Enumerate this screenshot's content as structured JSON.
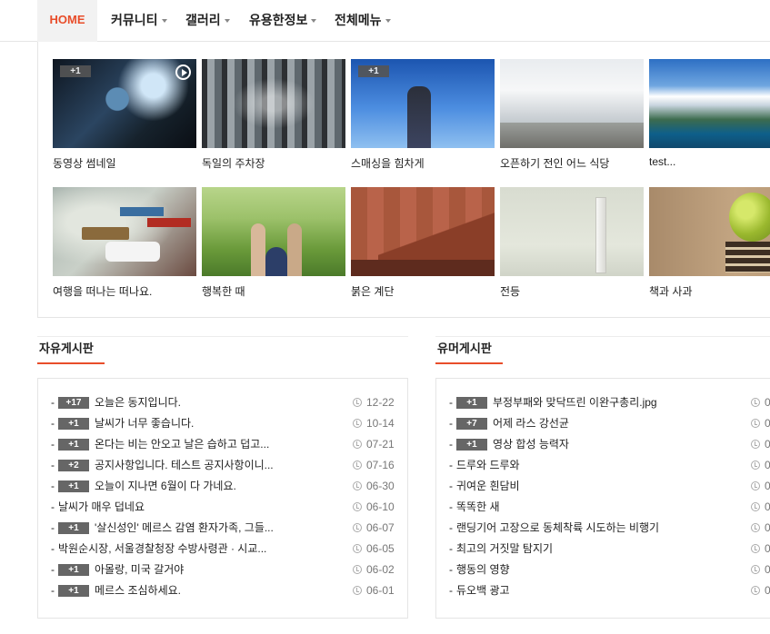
{
  "nav": {
    "home": "HOME",
    "items": [
      "커뮤니티",
      "갤러리",
      "유용한정보",
      "전체메뉴"
    ]
  },
  "gallery": [
    {
      "caption": "동영상 썸네일",
      "badge": "+1",
      "video": true
    },
    {
      "caption": "독일의 주차장"
    },
    {
      "caption": "스매싱을 힘차게",
      "badge": "+1"
    },
    {
      "caption": "오픈하기 전인 어느 식당"
    },
    {
      "caption": "test..."
    },
    {
      "caption": "여행을 떠나는 떠나요."
    },
    {
      "caption": "행복한 때"
    },
    {
      "caption": "붉은 계단"
    },
    {
      "caption": "전등"
    },
    {
      "caption": "책과 사과"
    }
  ],
  "free_board": {
    "title": "자유게시판",
    "posts": [
      {
        "badge": "+17",
        "title": "오늘은 동지입니다.",
        "date": "12-22"
      },
      {
        "badge": "+1",
        "title": "날씨가 너무 좋습니다.",
        "date": "10-14"
      },
      {
        "badge": "+1",
        "title": "온다는 비는 안오고 날은 습하고 덥고...",
        "date": "07-21"
      },
      {
        "badge": "+2",
        "title": "공지사항입니다. 테스트 공지사항이니...",
        "date": "07-16"
      },
      {
        "badge": "+1",
        "title": "오늘이 지나면 6월이 다 가네요.",
        "date": "06-30"
      },
      {
        "badge": "",
        "title": "날씨가 매우 덥네요",
        "date": "06-10"
      },
      {
        "badge": "+1",
        "title": "'살신성인' 메르스 감염 환자가족, 그들...",
        "date": "06-07"
      },
      {
        "badge": "",
        "title": "박원순시장, 서울경찰청장 수방사령관 · 시교...",
        "date": "06-05"
      },
      {
        "badge": "+1",
        "title": "아몰랑, 미국 갈거야",
        "date": "06-02"
      },
      {
        "badge": "+1",
        "title": "메르스 조심하세요.",
        "date": "06-01"
      }
    ]
  },
  "humor_board": {
    "title": "유머게시판",
    "posts": [
      {
        "badge": "+1",
        "title": "부정부패와 맞닥뜨린 이완구총리.jpg",
        "date": "0"
      },
      {
        "badge": "+7",
        "title": "어제 라스 강선균",
        "date": "0"
      },
      {
        "badge": "+1",
        "title": "영상 합성 능력자",
        "date": "0"
      },
      {
        "badge": "",
        "title": "드루와 드루와",
        "date": "0"
      },
      {
        "badge": "",
        "title": "귀여운 흰담비",
        "date": "0"
      },
      {
        "badge": "",
        "title": "똑똑한 새",
        "date": "0"
      },
      {
        "badge": "",
        "title": "랜딩기어 고장으로 동체착륙 시도하는 비행기",
        "date": "0"
      },
      {
        "badge": "",
        "title": "최고의 거짓말 탐지기",
        "date": "0"
      },
      {
        "badge": "",
        "title": "행동의 영향",
        "date": "0"
      },
      {
        "badge": "",
        "title": "듀오백 광고",
        "date": "0"
      }
    ]
  },
  "colors": {
    "accent": "#e84d2a",
    "badge": "#666666"
  }
}
